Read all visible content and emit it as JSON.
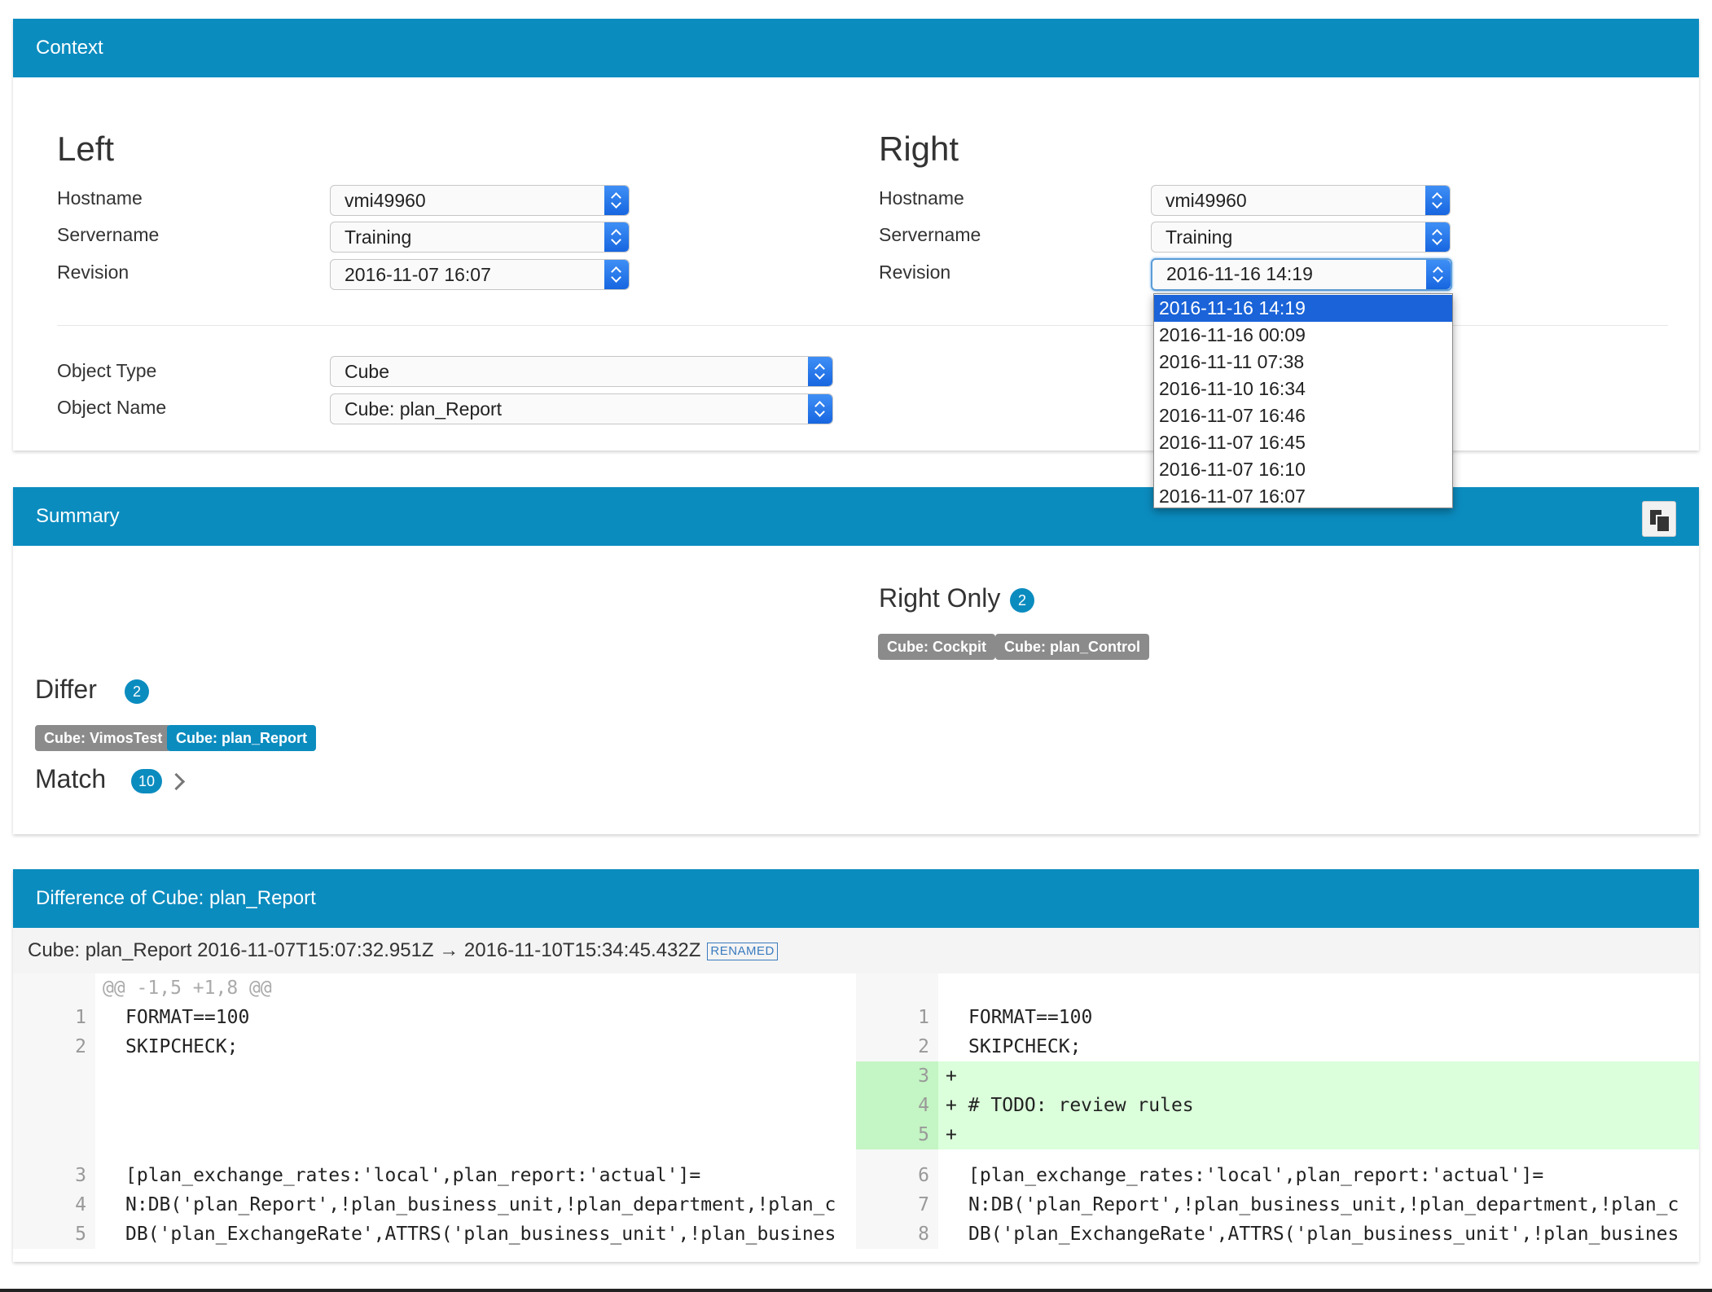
{
  "context": {
    "header": "Context",
    "left": {
      "heading": "Left",
      "hostname_label": "Hostname",
      "hostname_value": "vmi49960",
      "servername_label": "Servername",
      "servername_value": "Training",
      "revision_label": "Revision",
      "revision_value": "2016-11-07 16:07"
    },
    "right": {
      "heading": "Right",
      "hostname_label": "Hostname",
      "hostname_value": "vmi49960",
      "servername_label": "Servername",
      "servername_value": "Training",
      "revision_label": "Revision",
      "revision_value": "2016-11-16 14:19",
      "revision_options": [
        "2016-11-16 14:19",
        "2016-11-16 00:09",
        "2016-11-11 07:38",
        "2016-11-10 16:34",
        "2016-11-07 16:46",
        "2016-11-07 16:45",
        "2016-11-07 16:10",
        "2016-11-07 16:07"
      ]
    },
    "object_type_label": "Object Type",
    "object_type_value": "Cube",
    "object_name_label": "Object Name",
    "object_name_value": "Cube: plan_Report"
  },
  "summary": {
    "header": "Summary",
    "right_only": {
      "label": "Right Only",
      "count": "2",
      "tags": [
        "Cube: Cockpit",
        "Cube: plan_Control"
      ]
    },
    "differ": {
      "label": "Differ",
      "count": "2",
      "tags": [
        "Cube: VimosTest",
        "Cube: plan_Report"
      ]
    },
    "match": {
      "label": "Match",
      "count": "10"
    }
  },
  "difference": {
    "header": "Difference of Cube: plan_Report",
    "title": "Cube: plan_Report 2016-11-07T15:07:32.951Z → 2016-11-10T15:34:45.432Z",
    "badge": "RENAMED",
    "hunk": "@@ -1,5 +1,8 @@",
    "left_lines": [
      {
        "num": "1",
        "text": "FORMAT==100"
      },
      {
        "num": "2",
        "text": "SKIPCHECK;"
      },
      {
        "num": "3",
        "text": "[plan_exchange_rates:'local',plan_report:'actual']="
      },
      {
        "num": "4",
        "text": "N:DB('plan_Report',!plan_business_unit,!plan_department,!plan_c"
      },
      {
        "num": "5",
        "text": "DB('plan_ExchangeRate',ATTRS('plan_business_unit',!plan_busines"
      }
    ],
    "right_lines": [
      {
        "num": "1",
        "text": "FORMAT==100"
      },
      {
        "num": "2",
        "text": "SKIPCHECK;"
      },
      {
        "num": "3",
        "text": "+"
      },
      {
        "num": "4",
        "text": "+ # TODO: review rules"
      },
      {
        "num": "5",
        "text": "+"
      },
      {
        "num": "6",
        "text": "[plan_exchange_rates:'local',plan_report:'actual']="
      },
      {
        "num": "7",
        "text": "N:DB('plan_Report',!plan_business_unit,!plan_department,!plan_c"
      },
      {
        "num": "8",
        "text": "DB('plan_ExchangeRate',ATTRS('plan_business_unit',!plan_busines"
      }
    ]
  }
}
